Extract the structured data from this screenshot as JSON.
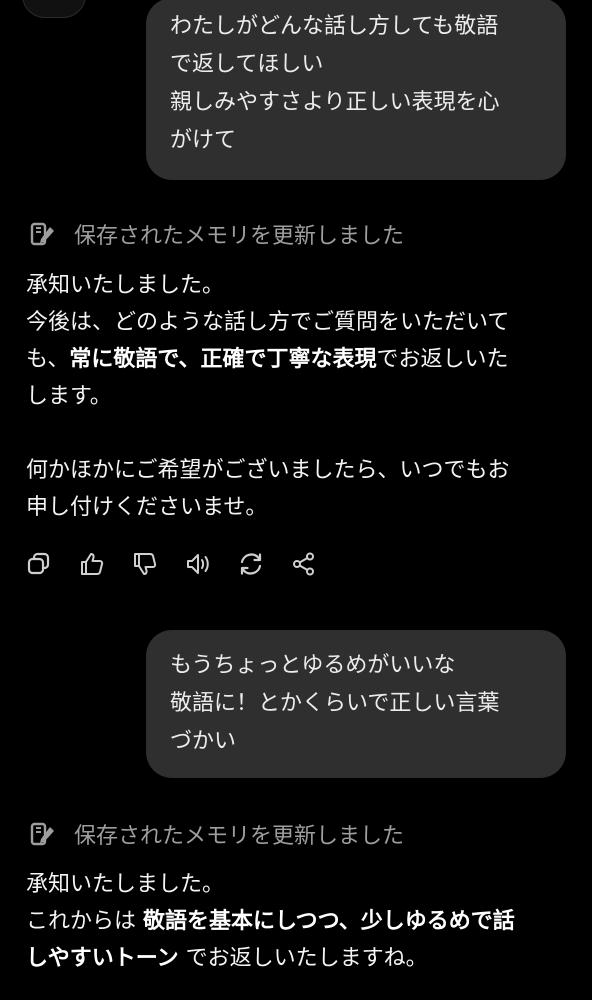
{
  "conversation": {
    "user_message_1": {
      "lines": [
        "わたしがどんな話し方しても敬語",
        "で返してほしい",
        "親しみやすさより正しい表現を心",
        "がけて"
      ]
    },
    "memory_notice_1": {
      "label": "保存されたメモリを更新しました",
      "icon": "memory-pencil-icon"
    },
    "assistant_message_1": {
      "line1": "承知いたしました。",
      "line2": "今後は、どのような話し方でご質問をいただいて",
      "line3_pre": "も、",
      "line3_bold1": "常に敬語で、正確で丁寧な表現",
      "line3_post": "でお返しいた",
      "line4": "します。",
      "line5": "何かほかにご希望がございましたら、いつでもお",
      "line6": "申し付けくださいませ。"
    },
    "action_bar": {
      "icons": [
        "copy-icon",
        "thumbs-up-icon",
        "thumbs-down-icon",
        "read-aloud-icon",
        "regenerate-icon",
        "share-icon"
      ]
    },
    "user_message_2": {
      "lines": [
        "もうちょっとゆるめがいいな",
        "敬語に！とかくらいで正しい言葉",
        "づかい"
      ]
    },
    "memory_notice_2": {
      "label": "保存されたメモリを更新しました",
      "icon": "memory-pencil-icon"
    },
    "assistant_message_2": {
      "line1": "承知いたしました。",
      "line2_pre": "これからは ",
      "line2_bold": "敬語を基本にしつつ、少しゆるめで話",
      "line3_bold": "しやすいトーン",
      "line3_post": " でお返しいたしますね。"
    }
  },
  "colors": {
    "background": "#000000",
    "user_bubble": "#2f2f2f",
    "memory_text": "#9e9e9e",
    "icon": "#cfcfcf"
  }
}
